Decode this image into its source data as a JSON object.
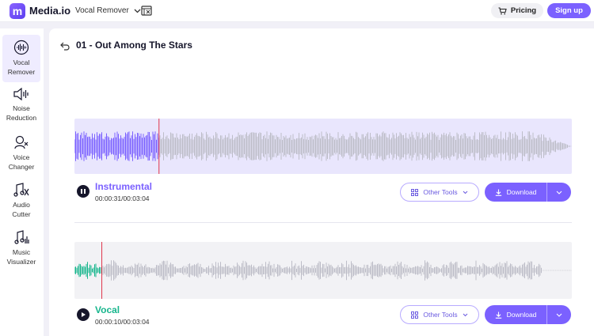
{
  "header": {
    "logo_mark": "m",
    "logo_text": "Media.io",
    "product_dropdown": "Vocal Remover",
    "pricing_label": "Pricing",
    "signup_label": "Sign up"
  },
  "sidebar": {
    "items": [
      {
        "label": "Vocal\nRemover",
        "icon": "vocal-remover-icon",
        "active": true
      },
      {
        "label": "Noise\nReduction",
        "icon": "noise-reduction-icon"
      },
      {
        "label": "Voice\nChanger",
        "icon": "voice-changer-icon"
      },
      {
        "label": "Audio\nCutter",
        "icon": "audio-cutter-icon"
      },
      {
        "label": "Music\nVisualizer",
        "icon": "music-visualizer-icon"
      }
    ]
  },
  "main": {
    "title": "01 - Out Among The Stars",
    "tracks": [
      {
        "name": "Instrumental",
        "time": "00:00:31/00:03:04",
        "state": "playing",
        "color": "#7b61ff",
        "progress": 0.17,
        "other_tools_label": "Other Tools",
        "download_label": "Download"
      },
      {
        "name": "Vocal",
        "time": "00:00:10/00:03:04",
        "state": "paused",
        "color": "#18b68d",
        "progress": 0.055,
        "other_tools_label": "Other Tools",
        "download_label": "Download"
      }
    ]
  },
  "colors": {
    "accent": "#7b61ff",
    "vocal": "#18b68d",
    "wave_gray": "#bdbdc8",
    "playhead": "#e0344a"
  }
}
